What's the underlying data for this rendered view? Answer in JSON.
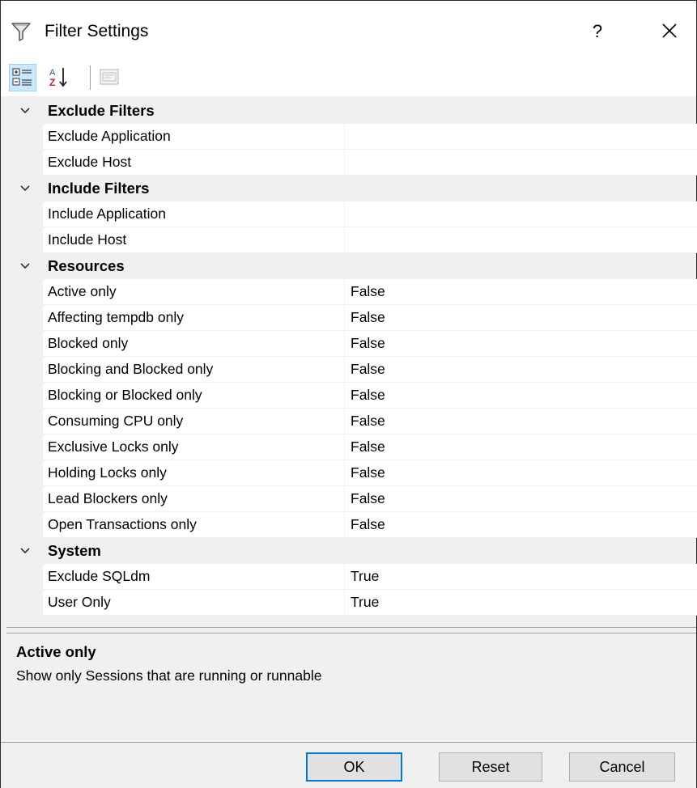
{
  "window": {
    "title": "Filter Settings",
    "help_label": "?",
    "close_icon": "close-icon",
    "title_icon": "funnel-icon"
  },
  "toolbar": {
    "categorized_icon": "categorized-view-icon",
    "alphabetical_icon": "sort-alphabetical-icon",
    "property_pages_icon": "property-pages-icon"
  },
  "grid": {
    "categories": [
      {
        "label": "Exclude Filters",
        "properties": [
          {
            "name": "Exclude Application",
            "value": ""
          },
          {
            "name": "Exclude Host",
            "value": ""
          }
        ]
      },
      {
        "label": "Include Filters",
        "properties": [
          {
            "name": "Include Application",
            "value": ""
          },
          {
            "name": "Include Host",
            "value": ""
          }
        ]
      },
      {
        "label": "Resources",
        "properties": [
          {
            "name": "Active only",
            "value": "False"
          },
          {
            "name": "Affecting tempdb only",
            "value": "False"
          },
          {
            "name": "Blocked only",
            "value": "False"
          },
          {
            "name": "Blocking and Blocked only",
            "value": "False"
          },
          {
            "name": "Blocking or Blocked only",
            "value": "False"
          },
          {
            "name": "Consuming CPU only",
            "value": "False"
          },
          {
            "name": "Exclusive Locks only",
            "value": "False"
          },
          {
            "name": "Holding Locks only",
            "value": "False"
          },
          {
            "name": "Lead Blockers only",
            "value": "False"
          },
          {
            "name": "Open Transactions only",
            "value": "False"
          }
        ]
      },
      {
        "label": "System",
        "properties": [
          {
            "name": "Exclude SQLdm",
            "value": "True"
          },
          {
            "name": "User Only",
            "value": "True"
          }
        ]
      }
    ]
  },
  "description": {
    "title": "Active only",
    "text": "Show only Sessions that are running or runnable"
  },
  "buttons": {
    "ok": "OK",
    "reset": "Reset",
    "cancel": "Cancel"
  },
  "colors": {
    "window_bg": "#f0f0f0",
    "toolbar_active_bg": "#cce8ff",
    "default_button_border": "#0078d7"
  }
}
